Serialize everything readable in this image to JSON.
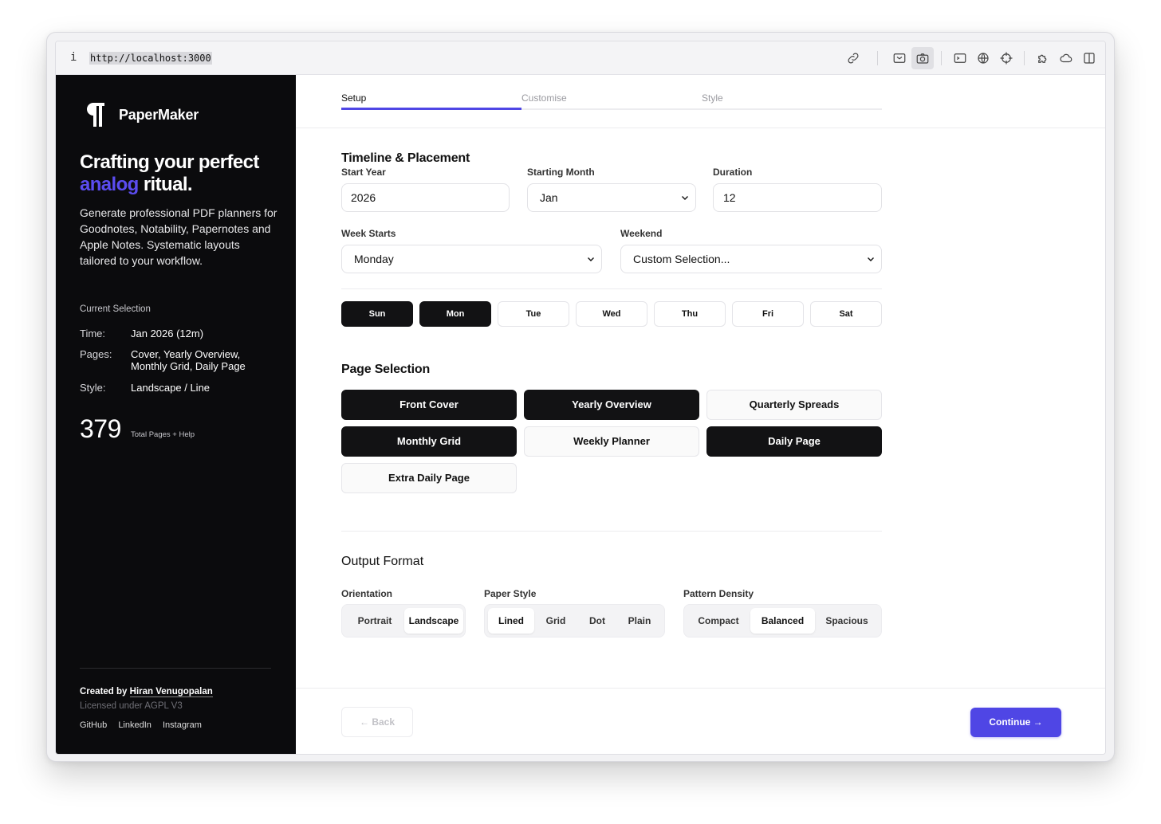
{
  "browser": {
    "info_glyph": "i",
    "url": "http://localhost:3000"
  },
  "sidebar": {
    "app_name": "PaperMaker",
    "headline_line1": "Crafting your perfect",
    "headline_accent": "analog",
    "headline_rest": " ritual.",
    "description": "Generate professional PDF planners for Goodnotes, Notability, Papernotes and Apple Notes. Systematic layouts tailored to your workflow.",
    "current_selection_label": "Current Selection",
    "selection": {
      "time_key": "Time:",
      "time_value": "Jan 2026 (12m)",
      "pages_key": "Pages:",
      "pages_value": "Cover, Yearly Overview, Monthly Grid, Daily Page",
      "style_key": "Style:",
      "style_value": "Landscape / Line"
    },
    "total_pages": "379",
    "total_pages_label": "Total Pages + Help",
    "credit_prefix": "Created by ",
    "credit_name": "Hiran Venugopalan",
    "license": "Licensed under AGPL V3",
    "links": [
      "GitHub",
      "LinkedIn",
      "Instagram"
    ]
  },
  "tabs": [
    "Setup",
    "Customise",
    "Style"
  ],
  "active_tab": "Setup",
  "timeline": {
    "title": "Timeline & Placement",
    "start_year_label": "Start Year",
    "start_year": "2026",
    "starting_month_label": "Starting Month",
    "starting_month": "Jan",
    "duration_label": "Duration",
    "duration": "12",
    "week_starts_label": "Week Starts",
    "week_starts": "Monday",
    "weekend_label": "Weekend",
    "weekend": "Custom Selection...",
    "days": [
      {
        "label": "Sun",
        "selected": true
      },
      {
        "label": "Mon",
        "selected": true
      },
      {
        "label": "Tue",
        "selected": false
      },
      {
        "label": "Wed",
        "selected": false
      },
      {
        "label": "Thu",
        "selected": false
      },
      {
        "label": "Fri",
        "selected": false
      },
      {
        "label": "Sat",
        "selected": false
      }
    ]
  },
  "page_selection": {
    "title": "Page Selection",
    "pages": [
      {
        "label": "Front Cover",
        "selected": true
      },
      {
        "label": "Yearly Overview",
        "selected": true
      },
      {
        "label": "Quarterly Spreads",
        "selected": false
      },
      {
        "label": "Monthly Grid",
        "selected": true
      },
      {
        "label": "Weekly Planner",
        "selected": false
      },
      {
        "label": "Daily Page",
        "selected": true
      },
      {
        "label": "Extra Daily Page",
        "selected": false
      }
    ]
  },
  "output": {
    "title": "Output Format",
    "orientation_label": "Orientation",
    "orientation_options": [
      "Portrait",
      "Landscape"
    ],
    "orientation_selected": "Landscape",
    "paper_label": "Paper Style",
    "paper_options": [
      "Lined",
      "Grid",
      "Dot",
      "Plain"
    ],
    "paper_selected": "Lined",
    "density_label": "Pattern Density",
    "density_options": [
      "Compact",
      "Balanced",
      "Spacious"
    ],
    "density_selected": "Balanced"
  },
  "footer": {
    "back_label": "← Back",
    "continue_label": "Continue →"
  },
  "colors": {
    "accent": "#4f46e5",
    "sidebar_bg": "#0b0b0d",
    "selected_bg": "#121214"
  }
}
